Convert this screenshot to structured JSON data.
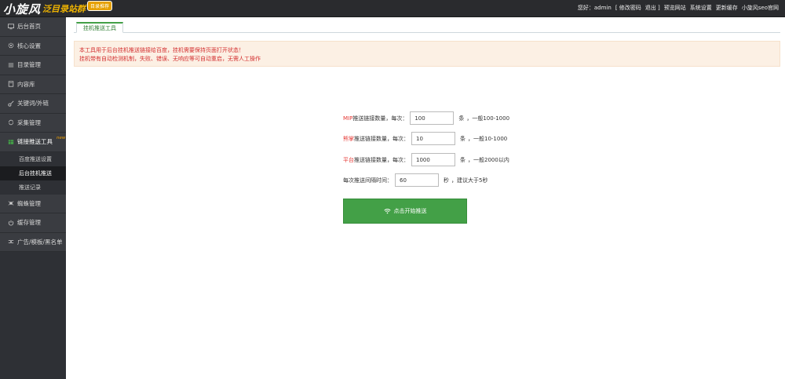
{
  "header": {
    "logo_main": "小旋风",
    "logo_sub": "泛目录站群",
    "logo_badge": "目录推荐",
    "nav": [
      "您好：admin",
      "[ 修改密码",
      "退出 ]",
      "预览网站",
      "系统设置",
      "更新缓存",
      "小旋风seo官网"
    ]
  },
  "sidebar": {
    "items": [
      {
        "label": "后台首页",
        "icon": "monitor-icon"
      },
      {
        "label": "核心设置",
        "icon": "gear-icon"
      },
      {
        "label": "目录管理",
        "icon": "list-icon"
      },
      {
        "label": "内容库",
        "icon": "book-icon"
      },
      {
        "label": "关键词/外链",
        "icon": "key-icon"
      },
      {
        "label": "采集管理",
        "icon": "sync-icon"
      },
      {
        "label": "链接推送工具",
        "icon": "table-icon",
        "badge": "new"
      },
      {
        "label": "蜘蛛管理",
        "icon": "spider-icon"
      },
      {
        "label": "缓存管理",
        "icon": "power-icon"
      },
      {
        "label": "广告/模板/黑名单",
        "icon": "shuffle-icon"
      }
    ],
    "subitems": [
      "百度推送设置",
      "后台挂机推送",
      "推送记录"
    ]
  },
  "main": {
    "tab": "挂机推送工具",
    "notice": [
      "本工具用于后台挂机推送链接给百度，挂机需要保持页面打开状态！",
      "挂机带有自动检测机制，失败、错误、无响应等可自动重启，无需人工操作"
    ]
  },
  "form": {
    "rows": [
      {
        "highlight": "MIP",
        "label": "推送链接数量，每次：",
        "value": "100",
        "unit": "条",
        "hint": "，一般100-1000"
      },
      {
        "highlight": "熊掌",
        "label": "推送链接数量，每次：",
        "value": "10",
        "unit": "条",
        "hint": "，一般10-1000"
      },
      {
        "highlight": "平台",
        "label": "推送链接数量，每次：",
        "value": "1000",
        "unit": "条",
        "hint": "，一般2000以内"
      }
    ],
    "interval": {
      "label": "每次推送间隔时间：",
      "value": "60",
      "unit": "秒",
      "hint": "，建议大于5秒"
    },
    "submit_label": "点击开始推送"
  },
  "colors": {
    "accent": "#43a047",
    "warning_text": "#d32f2f",
    "notice_bg": "#fcf0e4",
    "sidebar_bg": "#3a3c41",
    "header_bg": "#2a2b2e"
  }
}
